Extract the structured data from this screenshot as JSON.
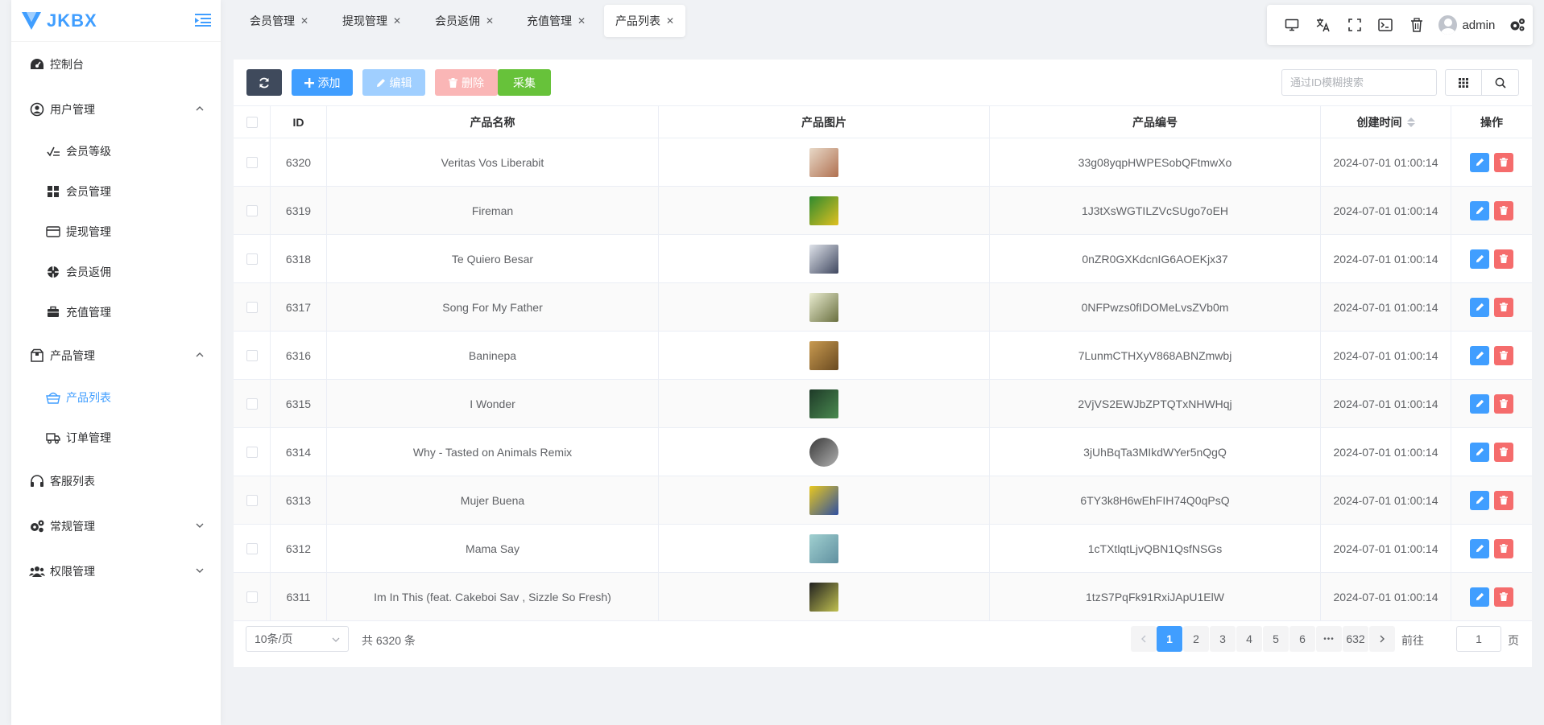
{
  "app": {
    "brand": "JKBX",
    "brand_color": "#409eff"
  },
  "sidebar": {
    "items": [
      {
        "label": "控制台",
        "icon": "dashboard-icon"
      },
      {
        "label": "用户管理",
        "icon": "user-circle-icon",
        "expanded": true
      },
      {
        "label": "会员等级",
        "icon": "level-icon"
      },
      {
        "label": "会员管理",
        "icon": "grid-icon"
      },
      {
        "label": "提现管理",
        "icon": "card-icon"
      },
      {
        "label": "会员返佣",
        "icon": "crosshair-icon"
      },
      {
        "label": "充值管理",
        "icon": "briefcase-icon"
      },
      {
        "label": "产品管理",
        "icon": "box-icon",
        "expanded": true
      },
      {
        "label": "产品列表",
        "icon": "basket-icon",
        "active": true
      },
      {
        "label": "订单管理",
        "icon": "truck-icon"
      },
      {
        "label": "客服列表",
        "icon": "headset-icon"
      },
      {
        "label": "常规管理",
        "icon": "gears-icon",
        "expanded": false
      },
      {
        "label": "权限管理",
        "icon": "users-icon",
        "expanded": false
      }
    ]
  },
  "tabs": [
    {
      "label": "会员管理"
    },
    {
      "label": "提现管理"
    },
    {
      "label": "会员返佣"
    },
    {
      "label": "充值管理"
    },
    {
      "label": "产品列表",
      "active": true
    }
  ],
  "header": {
    "username": "admin"
  },
  "toolbar": {
    "add_label": "添加",
    "edit_label": "编辑",
    "delete_label": "删除",
    "collect_label": "采集",
    "search_placeholder": "通过ID模糊搜索"
  },
  "table": {
    "columns": [
      "ID",
      "产品名称",
      "产品图片",
      "产品编号",
      "创建时间",
      "操作"
    ],
    "rows": [
      {
        "id": "6320",
        "name": "Veritas Vos Liberabit",
        "code": "33g08yqpHWPESobQFtmwXo",
        "time": "2024-07-01 01:00:14",
        "thumb": [
          "#e8d9c8",
          "#b07050"
        ]
      },
      {
        "id": "6319",
        "name": "Fireman",
        "code": "1J3tXsWGTILZVcSUgo7oEH",
        "time": "2024-07-01 01:00:14",
        "thumb": [
          "#2f8a2f",
          "#e0c020"
        ]
      },
      {
        "id": "6318",
        "name": "Te Quiero Besar",
        "code": "0nZR0GXKdcnIG6AOEKjx37",
        "time": "2024-07-01 01:00:14",
        "thumb": [
          "#dfe3ea",
          "#404860"
        ]
      },
      {
        "id": "6317",
        "name": "Song For My Father",
        "code": "0NFPwzs0fIDOMeLvsZVb0m",
        "time": "2024-07-01 01:00:14",
        "thumb": [
          "#e9ecd0",
          "#6a7040"
        ]
      },
      {
        "id": "6316",
        "name": "Baninepa",
        "code": "7LunmCTHXyV868ABNZmwbj",
        "time": "2024-07-01 01:00:14",
        "thumb": [
          "#c89a50",
          "#6a4a20"
        ]
      },
      {
        "id": "6315",
        "name": "I Wonder",
        "code": "2VjVS2EWJbZPTQTxNHWHqj",
        "time": "2024-07-01 01:00:14",
        "thumb": [
          "#1e3a28",
          "#4a8a50"
        ]
      },
      {
        "id": "6314",
        "name": "Why - Tasted on Animals Remix",
        "code": "3jUhBqTa3MIkdWYer5nQgQ",
        "time": "2024-07-01 01:00:14",
        "thumb": [
          "#3a3a3a",
          "#b0b0b0"
        ],
        "round": true
      },
      {
        "id": "6313",
        "name": "Mujer Buena",
        "code": "6TY3k8H6wEhFIH74Q0qPsQ",
        "time": "2024-07-01 01:00:14",
        "thumb": [
          "#e8c820",
          "#3050a0"
        ]
      },
      {
        "id": "6312",
        "name": "Mama Say",
        "code": "1cTXtlqtLjvQBN1QsfNSGs",
        "time": "2024-07-01 01:00:14",
        "thumb": [
          "#a0d0d0",
          "#6090a0"
        ]
      },
      {
        "id": "6311",
        "name": "Im In This (feat. Cakeboi Sav , Sizzle So Fresh)",
        "code": "1tzS7PqFk91RxiJApU1ElW",
        "time": "2024-07-01 01:00:14",
        "thumb": [
          "#202020",
          "#c0c050"
        ]
      }
    ]
  },
  "pager": {
    "page_size": "10条/页",
    "total": "共 6320 条",
    "pages": [
      "1",
      "2",
      "3",
      "4",
      "5",
      "6"
    ],
    "ellipsis": "•••",
    "last": "632",
    "goto_prefix": "前往",
    "goto_value": "1",
    "goto_suffix": "页"
  }
}
